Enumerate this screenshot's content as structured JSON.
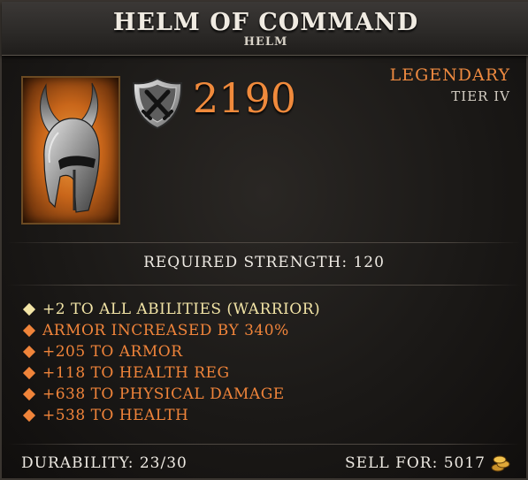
{
  "item": {
    "name": "HELM OF COMMAND",
    "type": "HELM",
    "armor": "2190",
    "rarity": "LEGENDARY",
    "tier": "TIER IV",
    "requirement": "REQUIRED STRENGTH: 120"
  },
  "attributes": [
    {
      "text": "+2 TO ALL ABILITIES (WARRIOR)",
      "color": "#f2e4a6"
    },
    {
      "text": "ARMOR INCREASED BY 340%",
      "color": "#f0843a"
    },
    {
      "text": "+205 TO ARMOR",
      "color": "#f0843a"
    },
    {
      "text": "+118 TO HEALTH REG",
      "color": "#f0843a"
    },
    {
      "text": "+638 TO PHYSICAL DAMAGE",
      "color": "#f0843a"
    },
    {
      "text": "+538 TO HEALTH",
      "color": "#f0843a"
    }
  ],
  "footer": {
    "durability": "DURABILITY: 23/30",
    "sell": "SELL FOR: 5017"
  },
  "colors": {
    "legendary": "#ee8a40",
    "primary_attribute": "#f2e4a6",
    "secondary_attribute": "#f0843a"
  },
  "icons": {
    "armor": "shield-crossed-swords-icon",
    "currency": "gold-coins-icon",
    "item": "horned-helm-image"
  }
}
